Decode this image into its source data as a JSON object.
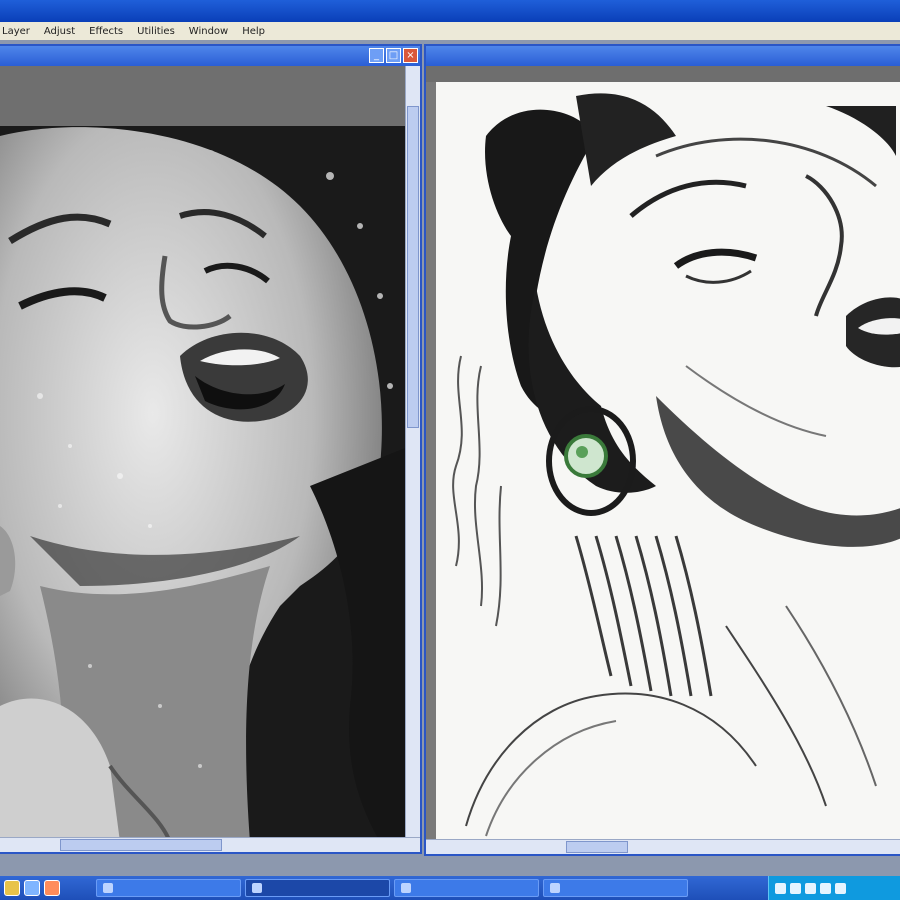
{
  "menu": {
    "items": [
      "Layer",
      "Adjust",
      "Effects",
      "Utilities",
      "Window",
      "Help"
    ]
  },
  "windows": {
    "left": {
      "title": ""
    },
    "right": {
      "title": ""
    }
  },
  "taskbar": {
    "buttons": [
      "",
      "",
      "",
      ""
    ]
  },
  "colors": {
    "title_blue": "#2a5ed6",
    "taskbar_blue": "#1e4fb8",
    "tray_blue": "#0f9adf"
  }
}
